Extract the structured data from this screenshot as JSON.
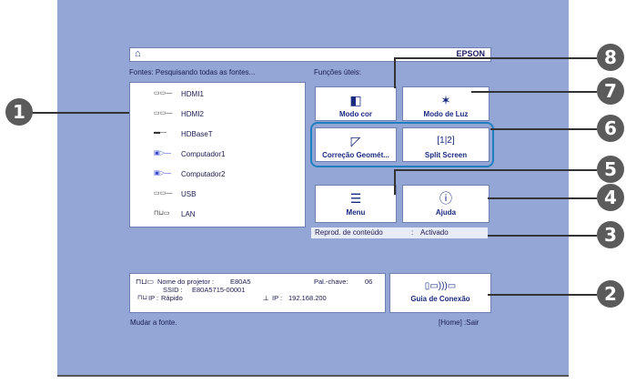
{
  "brand": "EPSON",
  "sources_label": "Fontes: Pesquisando todas as fontes...",
  "functions_label": "Funções úteis:",
  "sources": [
    {
      "label": "HDMI1",
      "icon": "hdmi-icon"
    },
    {
      "label": "HDMI2",
      "icon": "hdmi-icon"
    },
    {
      "label": "HDBaseT",
      "icon": "hdbaset-icon"
    },
    {
      "label": "Computador1",
      "icon": "vga-icon"
    },
    {
      "label": "Computador2",
      "icon": "vga-icon"
    },
    {
      "label": "USB",
      "icon": "usb-icon"
    },
    {
      "label": "LAN",
      "icon": "lan-icon"
    }
  ],
  "tiles": {
    "color_mode": "Modo cor",
    "light_mode": "Modo de Luz",
    "geometry": "Correção Geomét...",
    "split_screen": "Split Screen",
    "menu": "Menu",
    "help": "Ajuda"
  },
  "status": {
    "label": "Reprod. de conteúdo",
    "separator": ":",
    "value": "Activado"
  },
  "info": {
    "projector_name_label": "Nome do projetor :",
    "projector_name": "E80A5",
    "ssid_label": "SSID  :",
    "ssid": "E80A5715-00001",
    "ip_mode_label": "IP :",
    "ip_mode": "Rápido",
    "passphrase_label": "Pal.-chave:",
    "passphrase": "06",
    "ip_label": "IP :",
    "ip": "192.168.200"
  },
  "connection_guide": "Guia de Conexão",
  "footer_left": "Mudar a fonte.",
  "footer_right": "[Home] :Sair",
  "callouts": [
    "1",
    "2",
    "3",
    "4",
    "5",
    "6",
    "7",
    "8"
  ]
}
